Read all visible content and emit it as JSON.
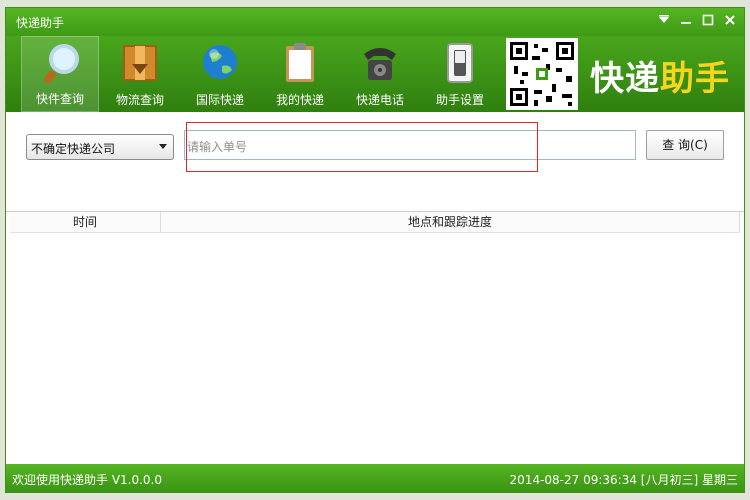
{
  "window": {
    "title": "快递助手"
  },
  "toolbar": {
    "items": [
      {
        "label": "快件查询",
        "icon": "magnifier-icon",
        "active": true
      },
      {
        "label": "物流查询",
        "icon": "box-icon",
        "active": false
      },
      {
        "label": "国际快递",
        "icon": "globe-icon",
        "active": false
      },
      {
        "label": "我的快递",
        "icon": "clipboard-icon",
        "active": false
      },
      {
        "label": "快递电话",
        "icon": "telephone-icon",
        "active": false
      },
      {
        "label": "助手设置",
        "icon": "switch-icon",
        "active": false
      }
    ]
  },
  "brand": {
    "text_a": "快递",
    "text_b": "助手"
  },
  "search": {
    "company_select_value": "不确定快递公司",
    "tracking_placeholder": "请输入单号",
    "query_button": "查 询(C)"
  },
  "table": {
    "columns": [
      "时间",
      "地点和跟踪进度"
    ]
  },
  "status": {
    "left": "欢迎使用快递助手 V1.0.0.0",
    "right": "2014-08-27 09:36:34 [八月初三]  星期三"
  },
  "colors": {
    "primary_green": "#3f9a16",
    "brand_yellow": "#f7d51d",
    "annotation_red": "#e22424"
  }
}
